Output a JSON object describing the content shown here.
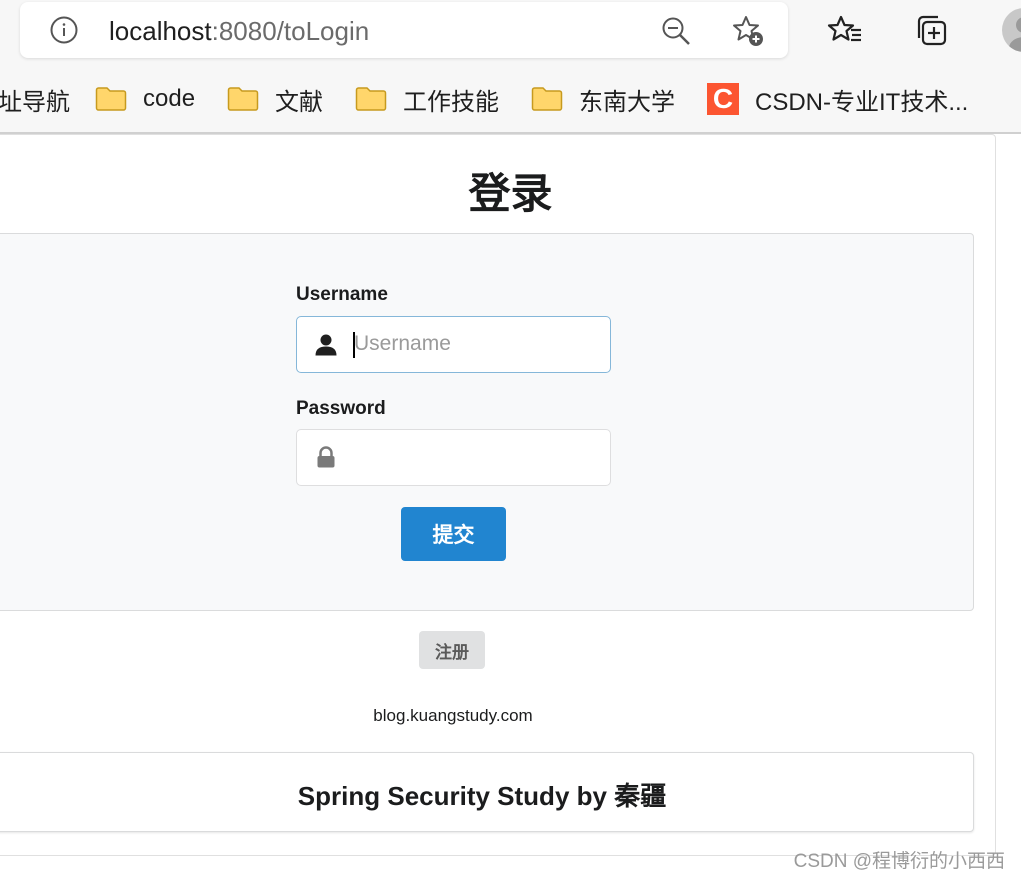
{
  "browser": {
    "url_host": "localhost",
    "url_path": ":8080/toLogin",
    "icons": [
      "info-icon",
      "zoom-out-icon",
      "add-favorite-icon",
      "favorites-icon",
      "collections-icon",
      "avatar"
    ]
  },
  "bookmarks": [
    {
      "label": "址导航",
      "icon": "none"
    },
    {
      "label": "code",
      "icon": "folder-icon"
    },
    {
      "label": "文献",
      "icon": "folder-icon"
    },
    {
      "label": "工作技能",
      "icon": "folder-icon"
    },
    {
      "label": "东南大学",
      "icon": "folder-icon"
    },
    {
      "label": "CSDN-专业IT技术...",
      "icon": "csdn-logo",
      "logo_letter": "C"
    }
  ],
  "login": {
    "title": "登录",
    "username_label": "Username",
    "username_placeholder": "Username",
    "username_icon": "user-icon",
    "password_label": "Password",
    "password_icon": "lock-icon",
    "submit_label": "提交",
    "register_label": "注册",
    "site": "blog.kuangstudy.com"
  },
  "footer": {
    "text": "Spring Security Study by 秦疆"
  },
  "watermark": "CSDN @程博衍的小西西",
  "colors": {
    "primary": "#2185d0",
    "csdn": "#fc5531",
    "folder": "#ffd66b"
  }
}
